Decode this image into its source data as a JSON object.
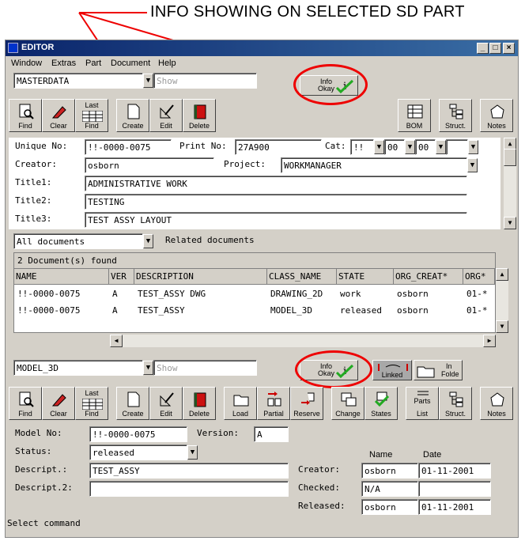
{
  "annotation": "INFO SHOWING ON SELECTED SD PART",
  "window": {
    "title": "EDITOR",
    "min": "_",
    "max": "□",
    "close": "×"
  },
  "menu": [
    "Window",
    "Extras",
    "Part",
    "Document",
    "Help"
  ],
  "masterdata": {
    "selector": "MASTERDATA",
    "show_placeholder": "Show",
    "info_label": "Info\nOkay"
  },
  "toolbar1": {
    "find": "Find",
    "clear": "Clear",
    "last_find_top": "Last",
    "last_find": "Find",
    "create": "Create",
    "edit": "Edit",
    "delete": "Delete",
    "bom": "BOM",
    "struct": "Struct.",
    "notes": "Notes"
  },
  "part": {
    "unique_no_label": "Unique No:",
    "unique_no": "!!-0000-0075",
    "print_no_label": "Print No:",
    "print_no": "27A900",
    "cat_label": "Cat:",
    "cat1": "!!",
    "cat2": "00",
    "cat3": "00",
    "cat4": "",
    "creator_label": "Creator:",
    "creator": "osborn",
    "project_label": "Project:",
    "project": "WORKMANAGER",
    "title1_label": "Title1:",
    "title1": "ADMINISTRATIVE WORK",
    "title2_label": "Title2:",
    "title2": "TESTING",
    "title3_label": "Title3:",
    "title3": "TEST ASSY LAYOUT"
  },
  "docs": {
    "filter": "All documents",
    "related_label": "Related documents",
    "found": "2 Document(s) found",
    "columns": [
      "NAME",
      "VER",
      "DESCRIPTION",
      "CLASS_NAME",
      "STATE",
      "ORG_CREAT*",
      "ORG*"
    ],
    "rows": [
      [
        "!!-0000-0075",
        "A",
        "TEST_ASSY DWG",
        "DRAWING_2D",
        "work",
        "osborn",
        "01-*"
      ],
      [
        "!!-0000-0075",
        "A",
        "TEST_ASSY",
        "MODEL_3D",
        "released",
        "osborn",
        "01-*"
      ]
    ]
  },
  "model": {
    "selector": "MODEL_3D",
    "show_placeholder": "Show",
    "info_label": "Info\nOkay",
    "linked": "Linked",
    "in_folder_top": "In",
    "in_folder": "Folde"
  },
  "toolbar2": {
    "find": "Find",
    "clear": "Clear",
    "last_find_top": "Last",
    "last_find": "Find",
    "create": "Create",
    "edit": "Edit",
    "delete": "Delete",
    "load": "Load",
    "partial": "Partial",
    "reserve": "Reserve",
    "change": "Change",
    "states": "States",
    "parts_list_top": "Parts",
    "parts_list": "List",
    "struct": "Struct.",
    "notes": "Notes"
  },
  "detail": {
    "model_no_label": "Model No:",
    "model_no": "!!-0000-0075",
    "version_label": "Version:",
    "version": "A",
    "status_label": "Status:",
    "status": "released",
    "descript_label": "Descript.:",
    "descript": "TEST_ASSY",
    "descript2_label": "Descript.2:",
    "descript2": "",
    "name_header": "Name",
    "date_header": "Date",
    "creator_label": "Creator:",
    "creator_name": "osborn",
    "creator_date": "01-11-2001",
    "checked_label": "Checked:",
    "checked_name": "N/A",
    "checked_date": "",
    "released_label": "Released:",
    "released_name": "osborn",
    "released_date": "01-11-2001"
  },
  "status_bar": "Select command",
  "colors": {
    "annotation_red": "#e00000",
    "check_green": "#22aa22",
    "titlebar": "#0a246a"
  }
}
